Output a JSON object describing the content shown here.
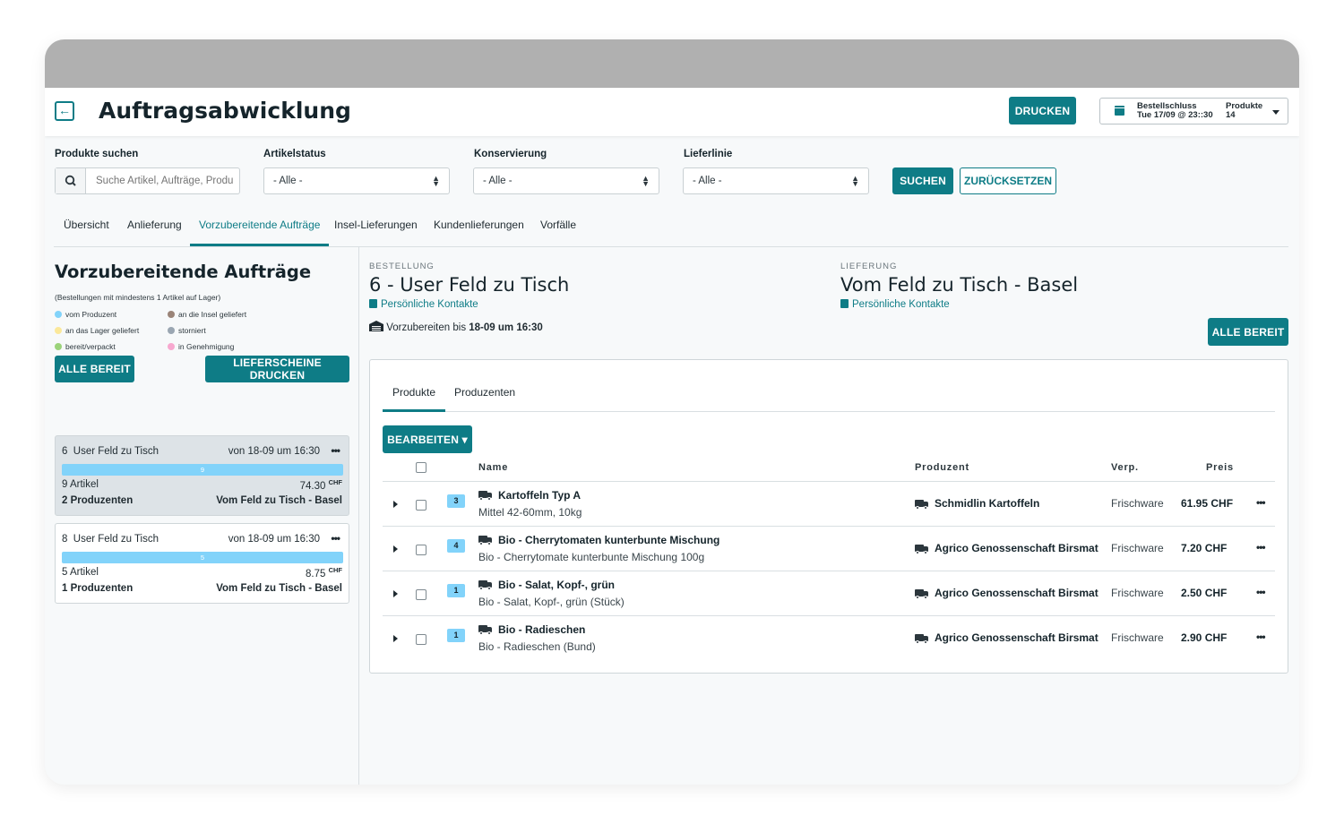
{
  "header": {
    "title": "Auftragsabwicklung",
    "print_label": "DRUCKEN",
    "deadline_label": "Bestellschluss",
    "deadline_value": "Tue 17/09 @ 23::30",
    "products_label": "Produkte",
    "products_value": "14"
  },
  "filters": {
    "search_label": "Produkte suchen",
    "search_placeholder": "Suche Artikel, Aufträge, Produ",
    "status_label": "Artikelstatus",
    "status_value": "- Alle -",
    "konservierung_label": "Konservierung",
    "konservierung_value": "- Alle -",
    "lieferlinie_label": "Lieferlinie",
    "lieferlinie_value": "- Alle -",
    "search_button": "SUCHEN",
    "reset_button": "ZURÜCKSETZEN"
  },
  "tabs": [
    "Übersicht",
    "Anlieferung",
    "Vorzubereitende Aufträge",
    "Insel-Lieferungen",
    "Kundenlieferungen",
    "Vorfälle"
  ],
  "left": {
    "title": "Vorzubereitende Aufträge",
    "hint": "(Bestellungen mit mindestens 1 Artikel auf Lager)",
    "legend": [
      {
        "label": "vom Produzent",
        "color": "#82d3fa"
      },
      {
        "label": "an die Insel geliefert",
        "color": "#9a8478"
      },
      {
        "label": "an das Lager geliefert",
        "color": "#fbe89a"
      },
      {
        "label": "storniert",
        "color": "#9aa6b2"
      },
      {
        "label": "bereit/verpackt",
        "color": "#9bd37a"
      },
      {
        "label": "in Genehmigung",
        "color": "#f7a8cf"
      }
    ],
    "all_ready_button": "ALLE BEREIT",
    "print_slips_button": "LIEFERSCHEINE DRUCKEN",
    "orders": [
      {
        "id_name": "6  User Feld zu Tisch",
        "date": "von 18-09 um 16:30",
        "bar": "9",
        "articles": "9 Artikel",
        "price": "74.30",
        "currency": "CHF",
        "producers": "2 Produzenten",
        "dest": "Vom Feld zu Tisch - Basel"
      },
      {
        "id_name": "8  User Feld zu Tisch",
        "date": "von 18-09 um 16:30",
        "bar": "5",
        "articles": "5 Artikel",
        "price": "8.75",
        "currency": "CHF",
        "producers": "1 Produzenten",
        "dest": "Vom Feld zu Tisch - Basel"
      }
    ]
  },
  "detail": {
    "order_caption": "BESTELLUNG",
    "order_name": "6 - User Feld zu Tisch",
    "contacts_label": "Persönliche Kontakte",
    "delivery_caption": "LIEFERUNG",
    "delivery_name": "Vom Feld zu Tisch - Basel",
    "prep_prefix": "Vorzubereiten bis ",
    "prep_value": "18-09 um 16:30",
    "all_ready_button": "ALLE BEREIT",
    "panel_tabs": [
      "Produkte",
      "Produzenten"
    ],
    "edit_button": "BEARBEITEN",
    "columns": {
      "name": "Name",
      "producer": "Produzent",
      "verp": "Verp.",
      "price": "Preis"
    },
    "rows": [
      {
        "qty": "3",
        "name": "Kartoffeln Typ A",
        "desc": "Mittel 42-60mm, 10kg",
        "producer": "Schmidlin Kartoffeln",
        "verp": "Frischware",
        "price": "61.95 CHF"
      },
      {
        "qty": "4",
        "name": "Bio - Cherrytomaten kunterbunte Mischung",
        "desc": "Bio - Cherrytomate kunterbunte Mischung 100g",
        "producer": "Agrico Genossenschaft Birsmat",
        "verp": "Frischware",
        "price": "7.20 CHF"
      },
      {
        "qty": "1",
        "name": "Bio - Salat, Kopf-, grün",
        "desc": "Bio - Salat, Kopf-, grün (Stück)",
        "producer": "Agrico Genossenschaft Birsmat",
        "verp": "Frischware",
        "price": "2.50 CHF"
      },
      {
        "qty": "1",
        "name": "Bio - Radieschen",
        "desc": "Bio - Radieschen (Bund)",
        "producer": "Agrico Genossenschaft Birsmat",
        "verp": "Frischware",
        "price": "2.90 CHF"
      }
    ]
  },
  "icons": {
    "back": "arrow-left-icon",
    "calendar": "calendar-icon",
    "search": "search-icon",
    "truck": "truck-icon",
    "contact": "contact-card-icon",
    "warehouse": "warehouse-icon",
    "more": "more-dots-icon"
  },
  "colors": {
    "accent": "#0e7c86",
    "bar": "#82d3fa",
    "titlebar": "#b0b0b0"
  }
}
